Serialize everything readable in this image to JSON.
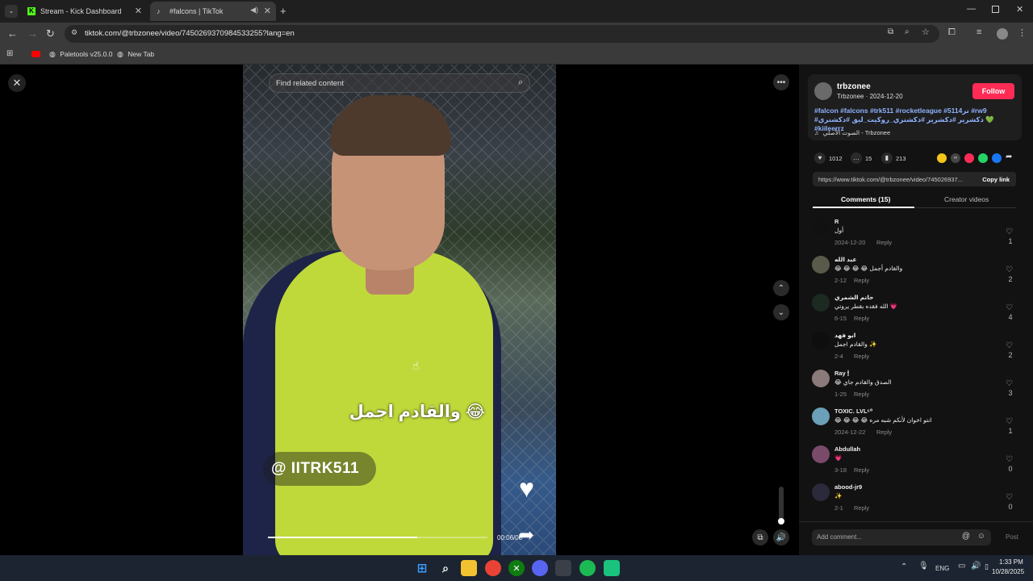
{
  "browser": {
    "tabs": [
      {
        "title": "Stream - Kick Dashboard",
        "icon": "kick-icon",
        "active": false
      },
      {
        "title": "#falcons | TikTok",
        "icon": "tiktok-icon",
        "active": true
      }
    ],
    "url": "tiktok.com/@trbzonee/video/7450269370984533255?lang=en",
    "bookmarks": [
      "Paletools v25.0.0",
      "New Tab"
    ]
  },
  "video": {
    "search_placeholder": "Find related content",
    "caption_text": "😂 والقادم اجمل",
    "handle_text": "@ IITRK511",
    "progress": 0.68,
    "time": "00:06/00"
  },
  "post": {
    "username": "trbzonee",
    "display_meta": "Trbzonee · 2024-12-20",
    "follow_label": "Follow",
    "hashtags_line1": "#falcon #falcons #trk511 #rocketleague #5114تر #rw9",
    "hashtags_line2": "#دكشرير #دكشرير #دكشنري_روكيت_ليق #دكشنري 💚 #kiileerrz",
    "sound": "الصوت الأصلي - Trbzonee",
    "likes": "1012",
    "comments_count": "15",
    "saves": "213",
    "link": "https://www.tiktok.com/@trbzonee/video/745026937...",
    "copy_link_label": "Copy link",
    "tab_comments": "Comments (15)",
    "tab_creator": "Creator videos"
  },
  "comments": [
    {
      "name": "R",
      "body": "أول",
      "date": "2024-12-20",
      "reply": "Reply",
      "likes": "1"
    },
    {
      "name": "عبد الله",
      "body": "😂 😂 😂 😂 والقادم أجمل",
      "date": "2-12",
      "reply": "Reply",
      "likes": "2"
    },
    {
      "name": "حاتم الشمري",
      "body": "الله فقده بقطر يروتي 💗",
      "date": "6-15",
      "reply": "Reply",
      "likes": "4"
    },
    {
      "name": "ابو فهد",
      "body": "والقادم اجمل ✨",
      "date": "2-4",
      "reply": "Reply",
      "likes": "2"
    },
    {
      "name": "Ray 🕯",
      "body": "😂 الصدق والقادم جاي",
      "date": "1-25",
      "reply": "Reply",
      "likes": "3"
    },
    {
      "name": "TOXIC. LVL⁶⁰",
      "body": "😂 😂 😂 😂 انتو اخوان لأنكم شبه مره",
      "date": "2024-12-22",
      "reply": "Reply",
      "likes": "1"
    },
    {
      "name": "Abdullah",
      "body": "💗",
      "date": "3-18",
      "reply": "Reply",
      "likes": "0"
    },
    {
      "name": "abood-jr9",
      "body": "✨",
      "date": "2-1",
      "reply": "Reply",
      "likes": "0"
    }
  ],
  "add_comment_placeholder": "Add comment...",
  "post_label": "Post",
  "taskbar": {
    "lang": "ENG",
    "time": "1:33 PM",
    "date": "10/28/2025"
  },
  "colors": {
    "accent": "#fe2c55",
    "hashtag": "#8fb2ff"
  }
}
